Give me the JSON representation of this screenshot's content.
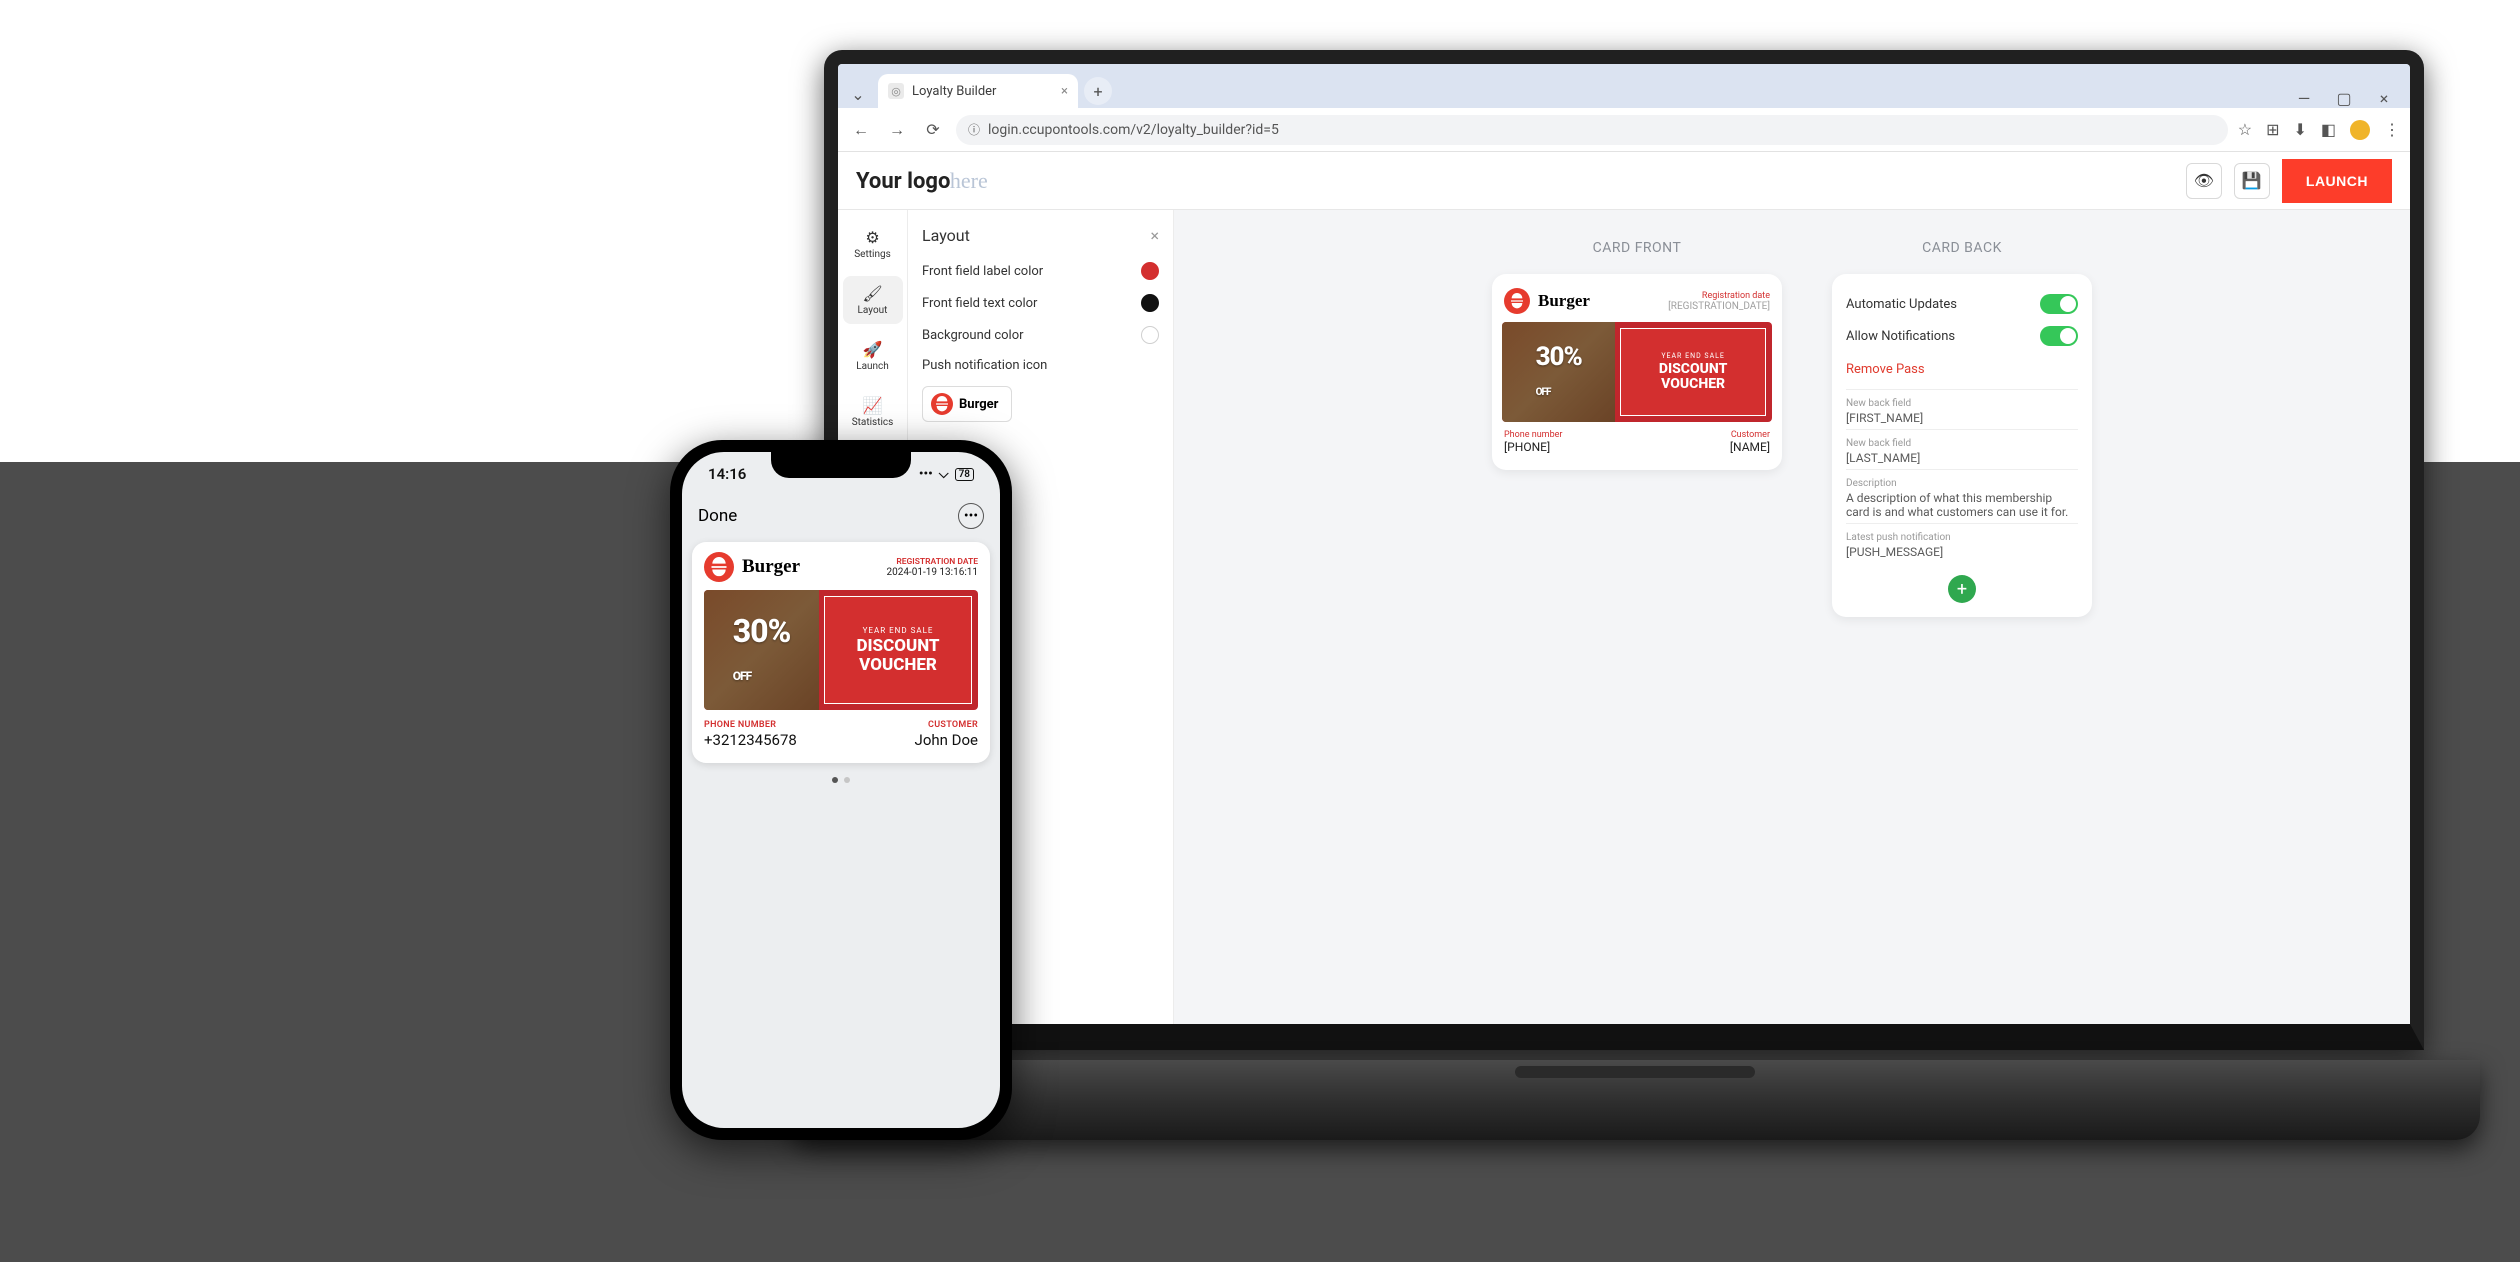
{
  "browser": {
    "tab_title": "Loyalty Builder",
    "url": "login.ccupontools.com/v2/loyalty_builder?id=5"
  },
  "app": {
    "logo": "Your logo",
    "logo_cursive": "here",
    "launch": "LAUNCH",
    "nav": [
      {
        "icon": "gear-icon",
        "label": "Settings"
      },
      {
        "icon": "brush-icon",
        "label": "Layout"
      },
      {
        "icon": "rocket-icon",
        "label": "Launch"
      },
      {
        "icon": "chart-icon",
        "label": "Statistics"
      }
    ],
    "layout_panel": {
      "title": "Layout",
      "front_label_color": "Front field label color",
      "front_text_color": "Front field text color",
      "background_color": "Background color",
      "push_icon": "Push notification icon",
      "brand": "Burger",
      "colors": {
        "label": "#d32f2f",
        "text": "#111111",
        "bg": "#ffffff"
      }
    },
    "canvas": {
      "front_title": "CARD FRONT",
      "back_title": "CARD BACK"
    },
    "card_front": {
      "brand": "Burger",
      "reg_label": "Registration date",
      "reg_value": "[REGISTRATION_DATE]",
      "strip_small": "YEAR END SALE",
      "strip_big1": "DISCOUNT",
      "strip_big2": "VOUCHER",
      "percent": "30%",
      "off": "OFF",
      "phone_label": "Phone number",
      "phone_value": "[PHONE]",
      "customer_label": "Customer",
      "customer_value": "[NAME]"
    },
    "card_back": {
      "auto_updates": "Automatic Updates",
      "allow_notifications": "Allow Notifications",
      "remove": "Remove Pass",
      "fields": [
        {
          "label": "New back field",
          "value": "[FIRST_NAME]"
        },
        {
          "label": "New back field",
          "value": "[LAST_NAME]"
        },
        {
          "label": "Description",
          "value": "A description of what this membership card is and what customers can use it for."
        },
        {
          "label": "Latest push notification",
          "value": "[PUSH_MESSAGE]"
        }
      ]
    }
  },
  "phone": {
    "time": "14:16",
    "battery": "78",
    "done": "Done",
    "card": {
      "brand": "Burger",
      "reg_label": "REGISTRATION DATE",
      "reg_value": "2024-01-19 13:16:11",
      "strip_small": "YEAR END SALE",
      "strip_big1": "DISCOUNT",
      "strip_big2": "VOUCHER",
      "percent": "30%",
      "off": "OFF",
      "phone_label": "PHONE NUMBER",
      "phone_value": "+3212345678",
      "customer_label": "CUSTOMER",
      "customer_value": "John Doe"
    }
  }
}
